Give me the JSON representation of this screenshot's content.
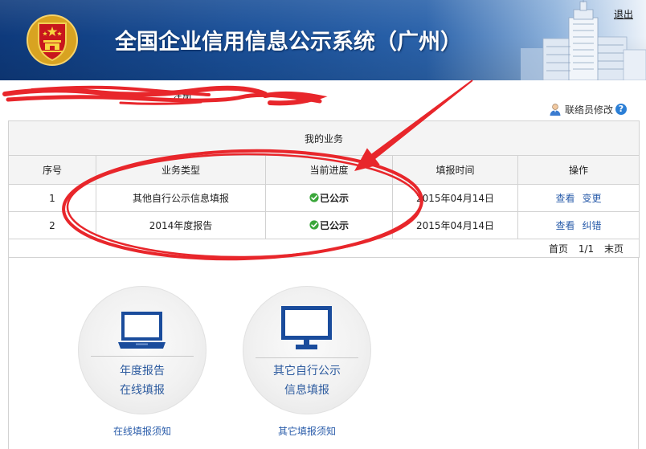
{
  "header": {
    "title": "全国企业信用信息公示系统（广州）",
    "logout": "退出"
  },
  "redacted": {
    "visible_fragment": "注册"
  },
  "toolbar": {
    "contact_edit": "联络员修改",
    "help_glyph": "?"
  },
  "table": {
    "caption": "我的业务",
    "columns": [
      "序号",
      "业务类型",
      "当前进度",
      "填报时间",
      "操作"
    ],
    "rows": [
      {
        "index": "1",
        "type": "其他自行公示信息填报",
        "status": "已公示",
        "date": "2015年04月14日",
        "actions": [
          "查看",
          "变更"
        ]
      },
      {
        "index": "2",
        "type": "2014年度报告",
        "status": "已公示",
        "date": "2015年04月14日",
        "actions": [
          "查看",
          "纠错"
        ]
      }
    ],
    "pagination": {
      "first": "首页",
      "page": "1/1",
      "last": "末页"
    }
  },
  "cards": [
    {
      "icon": "laptop-icon",
      "line1": "年度报告",
      "line2": "在线填报",
      "note": "在线填报须知"
    },
    {
      "icon": "monitor-icon",
      "line1": "其它自行公示",
      "line2": "信息填报",
      "note": "其它填报须知"
    }
  ],
  "colors": {
    "header_blue": "#1a5099",
    "link_blue": "#2a5caa",
    "icon_blue": "#1a4c9c",
    "status_green": "#3aa63a",
    "annotation_red": "#e8262b"
  }
}
